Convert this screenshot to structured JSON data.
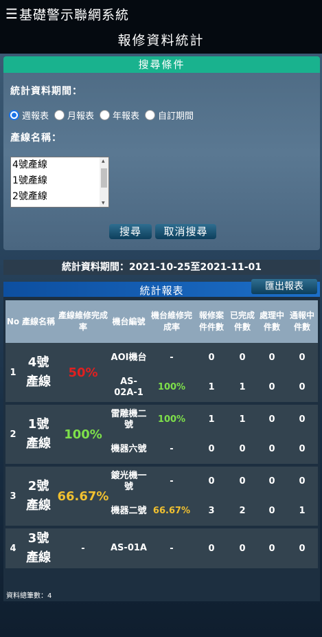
{
  "header": {
    "menu_icon": "☰",
    "app_title": "基礎警示聯網系統"
  },
  "page_title": "報修資料統計",
  "search": {
    "title": "搜尋條件",
    "period_label": "統計資料期間：",
    "period_options": [
      "週報表",
      "月報表",
      "年報表",
      "自訂期間"
    ],
    "period_selected": "週報表",
    "line_label": "產線名稱：",
    "line_options": [
      "4號產線",
      "1號產線",
      "2號產線"
    ],
    "search_button": "搜尋",
    "cancel_button": "取消搜尋"
  },
  "period_text": "統計資料期間：2021-10-25至2021-11-01",
  "report": {
    "title": "統計報表",
    "export_button": "匯出報表",
    "columns": [
      "No",
      "產線名稱",
      "產線維修完成率",
      "機台編號",
      "機台維修完成率",
      "報修案件件數",
      "已完成件數",
      "處理中件數",
      "通報中件數"
    ],
    "groups": [
      {
        "no": "1",
        "line": [
          "4號",
          "產線"
        ],
        "rate": "50%",
        "rate_color": "#e02020",
        "machines": [
          {
            "id": "AOI機台",
            "rate": "-",
            "reported": "0",
            "done": "0",
            "processing": "0",
            "notifying": "0"
          },
          {
            "id": "AS-02A-1",
            "rate": "100%",
            "reported": "1",
            "done": "1",
            "processing": "0",
            "notifying": "0"
          }
        ]
      },
      {
        "no": "2",
        "line": [
          "1號",
          "產線"
        ],
        "rate": "100%",
        "rate_color": "#7ee04a",
        "machines": [
          {
            "id": "雷雕機二號",
            "rate": "100%",
            "reported": "1",
            "done": "1",
            "processing": "0",
            "notifying": "0"
          },
          {
            "id": "機器六號",
            "rate": "-",
            "reported": "0",
            "done": "0",
            "processing": "0",
            "notifying": "0"
          }
        ]
      },
      {
        "no": "3",
        "line": [
          "2號",
          "產線"
        ],
        "rate": "66.67%",
        "rate_color": "#f0c030",
        "machines": [
          {
            "id": "鍍光機一號",
            "rate": "-",
            "reported": "0",
            "done": "0",
            "processing": "0",
            "notifying": "0"
          },
          {
            "id": "機器二號",
            "rate": "66.67%",
            "reported": "3",
            "done": "2",
            "processing": "0",
            "notifying": "1"
          }
        ]
      },
      {
        "no": "4",
        "line": [
          "3號",
          "產線"
        ],
        "rate": "-",
        "rate_color": "#ffffff",
        "machines": [
          {
            "id": "AS-01A",
            "rate": "-",
            "reported": "0",
            "done": "0",
            "processing": "0",
            "notifying": "0"
          }
        ]
      }
    ],
    "total_text": "資料總筆數：4"
  }
}
